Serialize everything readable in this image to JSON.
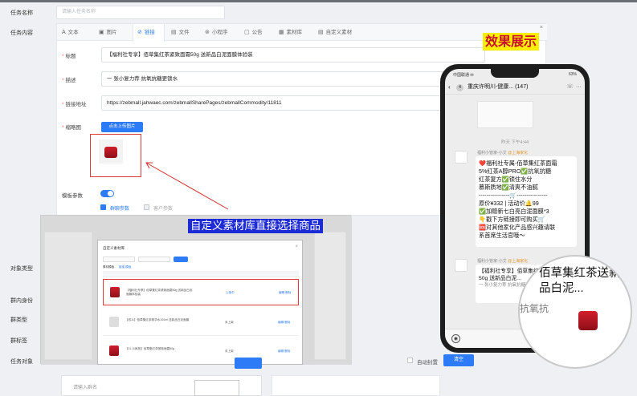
{
  "form": {
    "task_name_label": "任务名称",
    "task_name_placeholder": "请输入任务名称",
    "task_content_label": "任务内容",
    "object_type_label": "对象类型",
    "group_identity_label": "群内身份",
    "group_type_label": "群类型",
    "group_tag_label": "群标签",
    "task_object_label": "任务对象",
    "member_search_placeholder": "请输入群名"
  },
  "tabs": [
    {
      "icon": "A",
      "label": "文本"
    },
    {
      "icon": "▣",
      "label": "图片"
    },
    {
      "icon": "⊘",
      "label": "链接"
    },
    {
      "icon": "▤",
      "label": "文件"
    },
    {
      "icon": "⊚",
      "label": "小程序"
    },
    {
      "icon": "▢",
      "label": "公告"
    },
    {
      "icon": "▦",
      "label": "素材库"
    },
    {
      "icon": "▤",
      "label": "自定义素材"
    }
  ],
  "link_form": {
    "title_label": "标题",
    "title_value": "【福利社专享】佰草集红茶紧致面霜50g 送新品白泥面膜体验装",
    "desc_label": "描述",
    "desc_value": "一 张小复力荐 抗氧抗糖更锁水",
    "url_label": "链接地址",
    "url_value": "https://zebmall.jahwaec.com/zebmallSharePages/zebmallCommodity/11811",
    "thumb_label": "缩略图",
    "upload_button": "点击上传图片",
    "template_label": "模板参数",
    "opt_group_param": "群聊参数",
    "opt_customer_param": "客户参数"
  },
  "bottom": {
    "auto_pin_label": "自动封置",
    "clear_button": "清空"
  },
  "effect_title": "效果展示",
  "overlay_title": "自定义素材库直接选择商品",
  "phone": {
    "status_left": "中国联通 ✉",
    "status_right": "63%",
    "chat_badge": "4",
    "chat_title": "重庆许明川-健康...",
    "chat_count": "(147)",
    "timestamp": "昨天 下午4:44",
    "sender_name": "福利小管家-小艾",
    "sender_tag": "@上海家化",
    "message_lines": [
      "❤️福利社专属-佰草集红茶面霜",
      "5%红茶A醇PRO✅抗氧抗糖",
      "红茶复方✅锁住水分",
      "慕斯质地✅清爽不油腻",
      "----------------🛒----------------",
      "原价¥332 | 活动价🔔99",
      "✅加赠新七白亮白泥面膜*3",
      "👇戳下方链接即可购买🛒",
      "🆘对其他家化产品感兴趣请联",
      "系首席生活官哦～"
    ],
    "card_title": "【福利社专享】佰草集红茶紧致面霜50g 送新品白泥...",
    "card_desc": "一 张小复力荐 抗氧抗糖更锁水"
  },
  "zoom": {
    "title": "佰草集红茶送新品白泥...",
    "desc": "抗氧抗"
  },
  "modal": {
    "title": "自定义素材库",
    "tab_label": "素材模板",
    "tab_hint": "链接 模板",
    "rows": [
      {
        "text": "【福利社专享】佰草集红茶紧致面霜50g 送新品白泥面膜体验装",
        "tag": "上架中",
        "actions": "编辑 删除"
      },
      {
        "text": "【双11】佰草集红茶精华水100ml 送新品白泥面膜",
        "tag": "未上架",
        "actions": "编辑 删除"
      },
      {
        "text": "【11.11疯抢】佰草集红茶紧致面霜50g",
        "tag": "未上架",
        "actions": "编辑 删除"
      }
    ]
  }
}
